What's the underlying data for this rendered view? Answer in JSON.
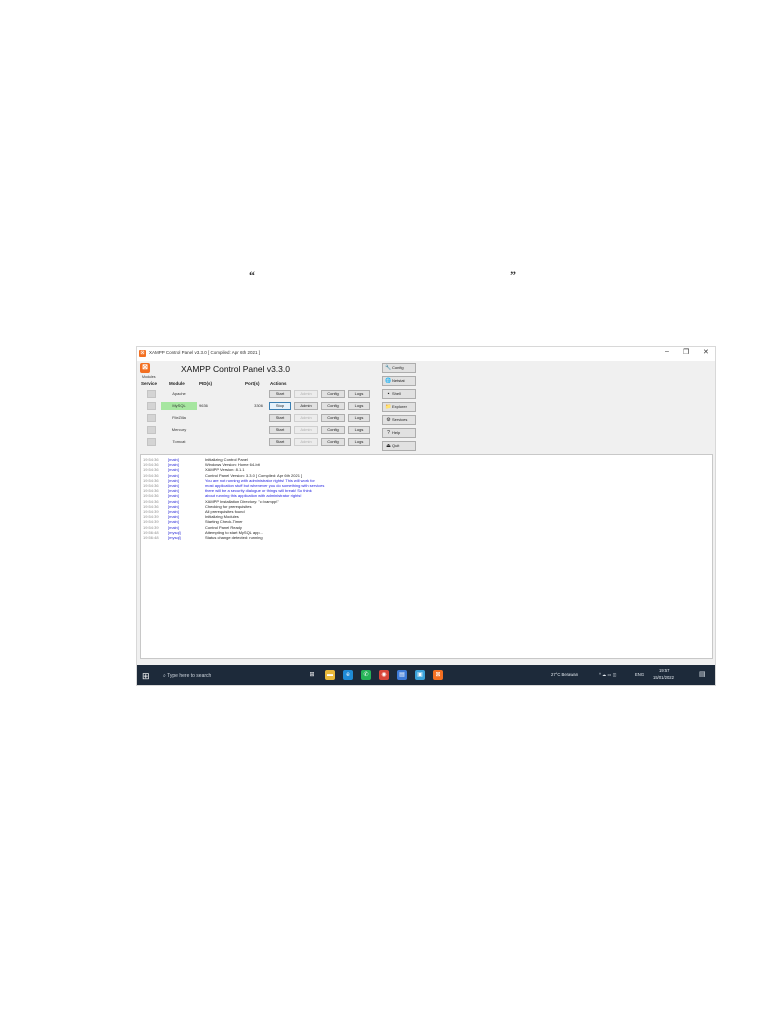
{
  "quotes": {
    "open": "“",
    "close": "”"
  },
  "window": {
    "title": "XAMPP Control Panel v3.3.0   [ Compiled: Apr 6th 2021 ]",
    "minimize": "–",
    "maximize": "❐",
    "close": "✕"
  },
  "header": {
    "app_title": "XAMPP Control Panel v3.3.0",
    "modules_label": "Modules",
    "columns": [
      "Service",
      "Module",
      "PID(s)",
      "Port(s)",
      "Actions"
    ]
  },
  "modules": [
    {
      "name": "Apache",
      "pid": "",
      "port": "",
      "start": "Start",
      "admin": "Admin",
      "config": "Config",
      "logs": "Logs",
      "running": false
    },
    {
      "name": "MySQL",
      "pid": "9636",
      "port": "3306",
      "start": "Stop",
      "admin": "Admin",
      "config": "Config",
      "logs": "Logs",
      "running": true
    },
    {
      "name": "FileZilla",
      "pid": "",
      "port": "",
      "start": "Start",
      "admin": "Admin",
      "config": "Config",
      "logs": "Logs",
      "running": false
    },
    {
      "name": "Mercury",
      "pid": "",
      "port": "",
      "start": "Start",
      "admin": "Admin",
      "config": "Config",
      "logs": "Logs",
      "running": false
    },
    {
      "name": "Tomcat",
      "pid": "",
      "port": "",
      "start": "Start",
      "admin": "Admin",
      "config": "Config",
      "logs": "Logs",
      "running": false
    }
  ],
  "side_buttons": [
    {
      "label": "Config",
      "icon": "wrench-icon",
      "glyph": "🔧"
    },
    {
      "label": "Netstat",
      "icon": "globe-icon",
      "glyph": "🌐"
    },
    {
      "label": "Shell",
      "icon": "terminal-icon",
      "glyph": "▪"
    },
    {
      "label": "Explorer",
      "icon": "folder-icon",
      "glyph": "📁"
    },
    {
      "label": "Services",
      "icon": "services-icon",
      "glyph": "⚙"
    },
    {
      "label": "Help",
      "icon": "help-icon",
      "glyph": "?"
    },
    {
      "label": "Quit",
      "icon": "quit-icon",
      "glyph": "⏏"
    }
  ],
  "log": [
    {
      "time": "19:54:36",
      "module": "[main]",
      "text": "Initializing Control Panel",
      "warn": false
    },
    {
      "time": "19:54:36",
      "module": "[main]",
      "text": "Windows Version:  Home  64-bit",
      "warn": false
    },
    {
      "time": "19:54:36",
      "module": "[main]",
      "text": "XAMPP Version: 8.1.1",
      "warn": false
    },
    {
      "time": "19:54:36",
      "module": "[main]",
      "text": "Control Panel Version: 3.3.0  [ Compiled: Apr 6th 2021 ]",
      "warn": false
    },
    {
      "time": "19:54:36",
      "module": "[main]",
      "text": "You are not running with administrator rights! This will work for",
      "warn": true
    },
    {
      "time": "19:54:36",
      "module": "[main]",
      "text": "most application stuff but whenever you do something with services",
      "warn": true
    },
    {
      "time": "19:54:36",
      "module": "[main]",
      "text": "there will be a security dialogue or things will break! So think",
      "warn": true
    },
    {
      "time": "19:54:36",
      "module": "[main]",
      "text": "about running this application with administrator rights!",
      "warn": true
    },
    {
      "time": "19:54:36",
      "module": "[main]",
      "text": "XAMPP Installation Directory: \"c:\\xampp\\\"",
      "warn": false
    },
    {
      "time": "19:54:36",
      "module": "[main]",
      "text": "Checking for prerequisites",
      "warn": false
    },
    {
      "time": "19:54:39",
      "module": "[main]",
      "text": "All prerequisites found",
      "warn": false
    },
    {
      "time": "19:54:39",
      "module": "[main]",
      "text": "Initializing Modules",
      "warn": false
    },
    {
      "time": "19:54:39",
      "module": "[main]",
      "text": "Starting Check-Timer",
      "warn": false
    },
    {
      "time": "19:54:39",
      "module": "[main]",
      "text": "Control Panel Ready",
      "warn": false
    },
    {
      "time": "19:56:48",
      "module": "[mysql]",
      "text": "Attempting to start MySQL app...",
      "warn": false
    },
    {
      "time": "19:56:48",
      "module": "[mysql]",
      "text": "Status change detected: running",
      "warn": false
    }
  ],
  "taskbar": {
    "search_placeholder": "Type here to search",
    "weather": "27°C  Berawan",
    "tray_icons": "^  ☁  ▭  ◫",
    "language": "ENG",
    "time": "19:57",
    "date": "15/01/2022",
    "pinned": [
      {
        "icon": "task-view-icon",
        "glyph": "⊞",
        "color": "#1d2a3a"
      },
      {
        "icon": "file-manager-icon",
        "glyph": "▬",
        "color": "#e8b93b"
      },
      {
        "icon": "edge-icon",
        "glyph": "e",
        "color": "#1f8bd6"
      },
      {
        "icon": "whatsapp-icon",
        "glyph": "✆",
        "color": "#25b357"
      },
      {
        "icon": "chrome-icon",
        "glyph": "◉",
        "color": "#d9463a"
      },
      {
        "icon": "store-icon",
        "glyph": "▤",
        "color": "#3e7bd9"
      },
      {
        "icon": "app-icon",
        "glyph": "▣",
        "color": "#3aa1d8"
      },
      {
        "icon": "xampp-icon",
        "glyph": "⊠",
        "color": "#f36f21"
      }
    ]
  }
}
